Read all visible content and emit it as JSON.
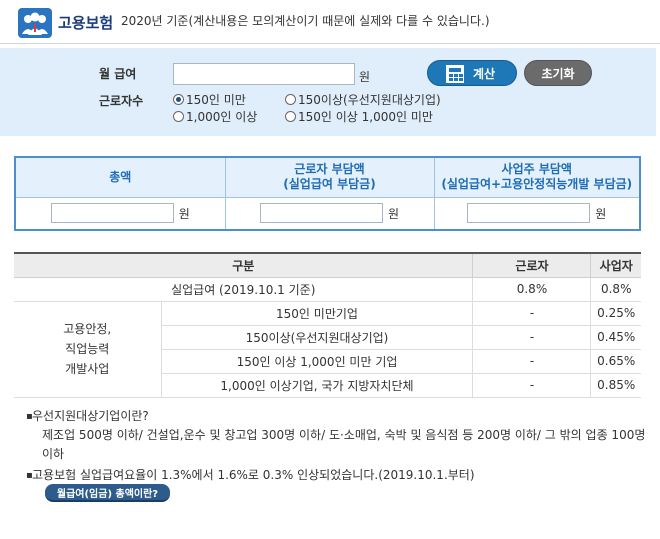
{
  "header": {
    "title": "고용보험",
    "note": "2020년 기준(계산내용은 모의계산이기 때문에 실제와 다를 수 있습니다.)"
  },
  "calc": {
    "wage_label": "월 급여",
    "wage_value": "",
    "wage_unit": "원",
    "workers_label": "근로자수",
    "options": [
      {
        "label": "150인 미만",
        "selected": true
      },
      {
        "label": "150이상(우선지원대상기업)",
        "selected": false
      },
      {
        "label": "1,000인 이상",
        "selected": false
      },
      {
        "label": "150인 이상 1,000인 미만",
        "selected": false
      }
    ],
    "calc_button": "계산",
    "reset_button": "초기화"
  },
  "result": {
    "headers": [
      {
        "title": "총액",
        "sub": ""
      },
      {
        "title": "근로자 부담액",
        "sub": "(실업급여 부담금)"
      },
      {
        "title": "사업주 부담액",
        "sub": "(실업급여+고용안정직능개발 부담금)"
      }
    ],
    "unit": "원"
  },
  "rates": {
    "headers": [
      "구분",
      "근로자",
      "사업자"
    ],
    "unemployment": {
      "label": "실업급여 (2019.10.1 기준)",
      "worker": "0.8%",
      "employer": "0.8%"
    },
    "group_label": "고용안정,\n직업능력\n개발사업",
    "rows": [
      {
        "label": "150인 미만기업",
        "worker": "-",
        "employer": "0.25%"
      },
      {
        "label": "150이상(우선지원대상기업)",
        "worker": "-",
        "employer": "0.45%"
      },
      {
        "label": "150인 이상 1,000인 미만 기업",
        "worker": "-",
        "employer": "0.65%"
      },
      {
        "label": "1,000인 이상기업, 국가 지방자치단체",
        "worker": "-",
        "employer": "0.85%"
      }
    ]
  },
  "notes": {
    "q_title": "우선지원대상기업이란?",
    "q_body": "제조업 500명 이하/ 건설업,운수 및 창고업 300명 이하/ 도·소매업, 숙박 및 음식점 등 200명 이하/ 그 밖의 업종 100명 이하",
    "rate_change": "고용보험 실업급여요율이 1.3%에서 1.6%로 0.3% 인상되었습니다.(2019.10.1.부터)",
    "define_button": "월급여(임금) 총액이란?"
  }
}
